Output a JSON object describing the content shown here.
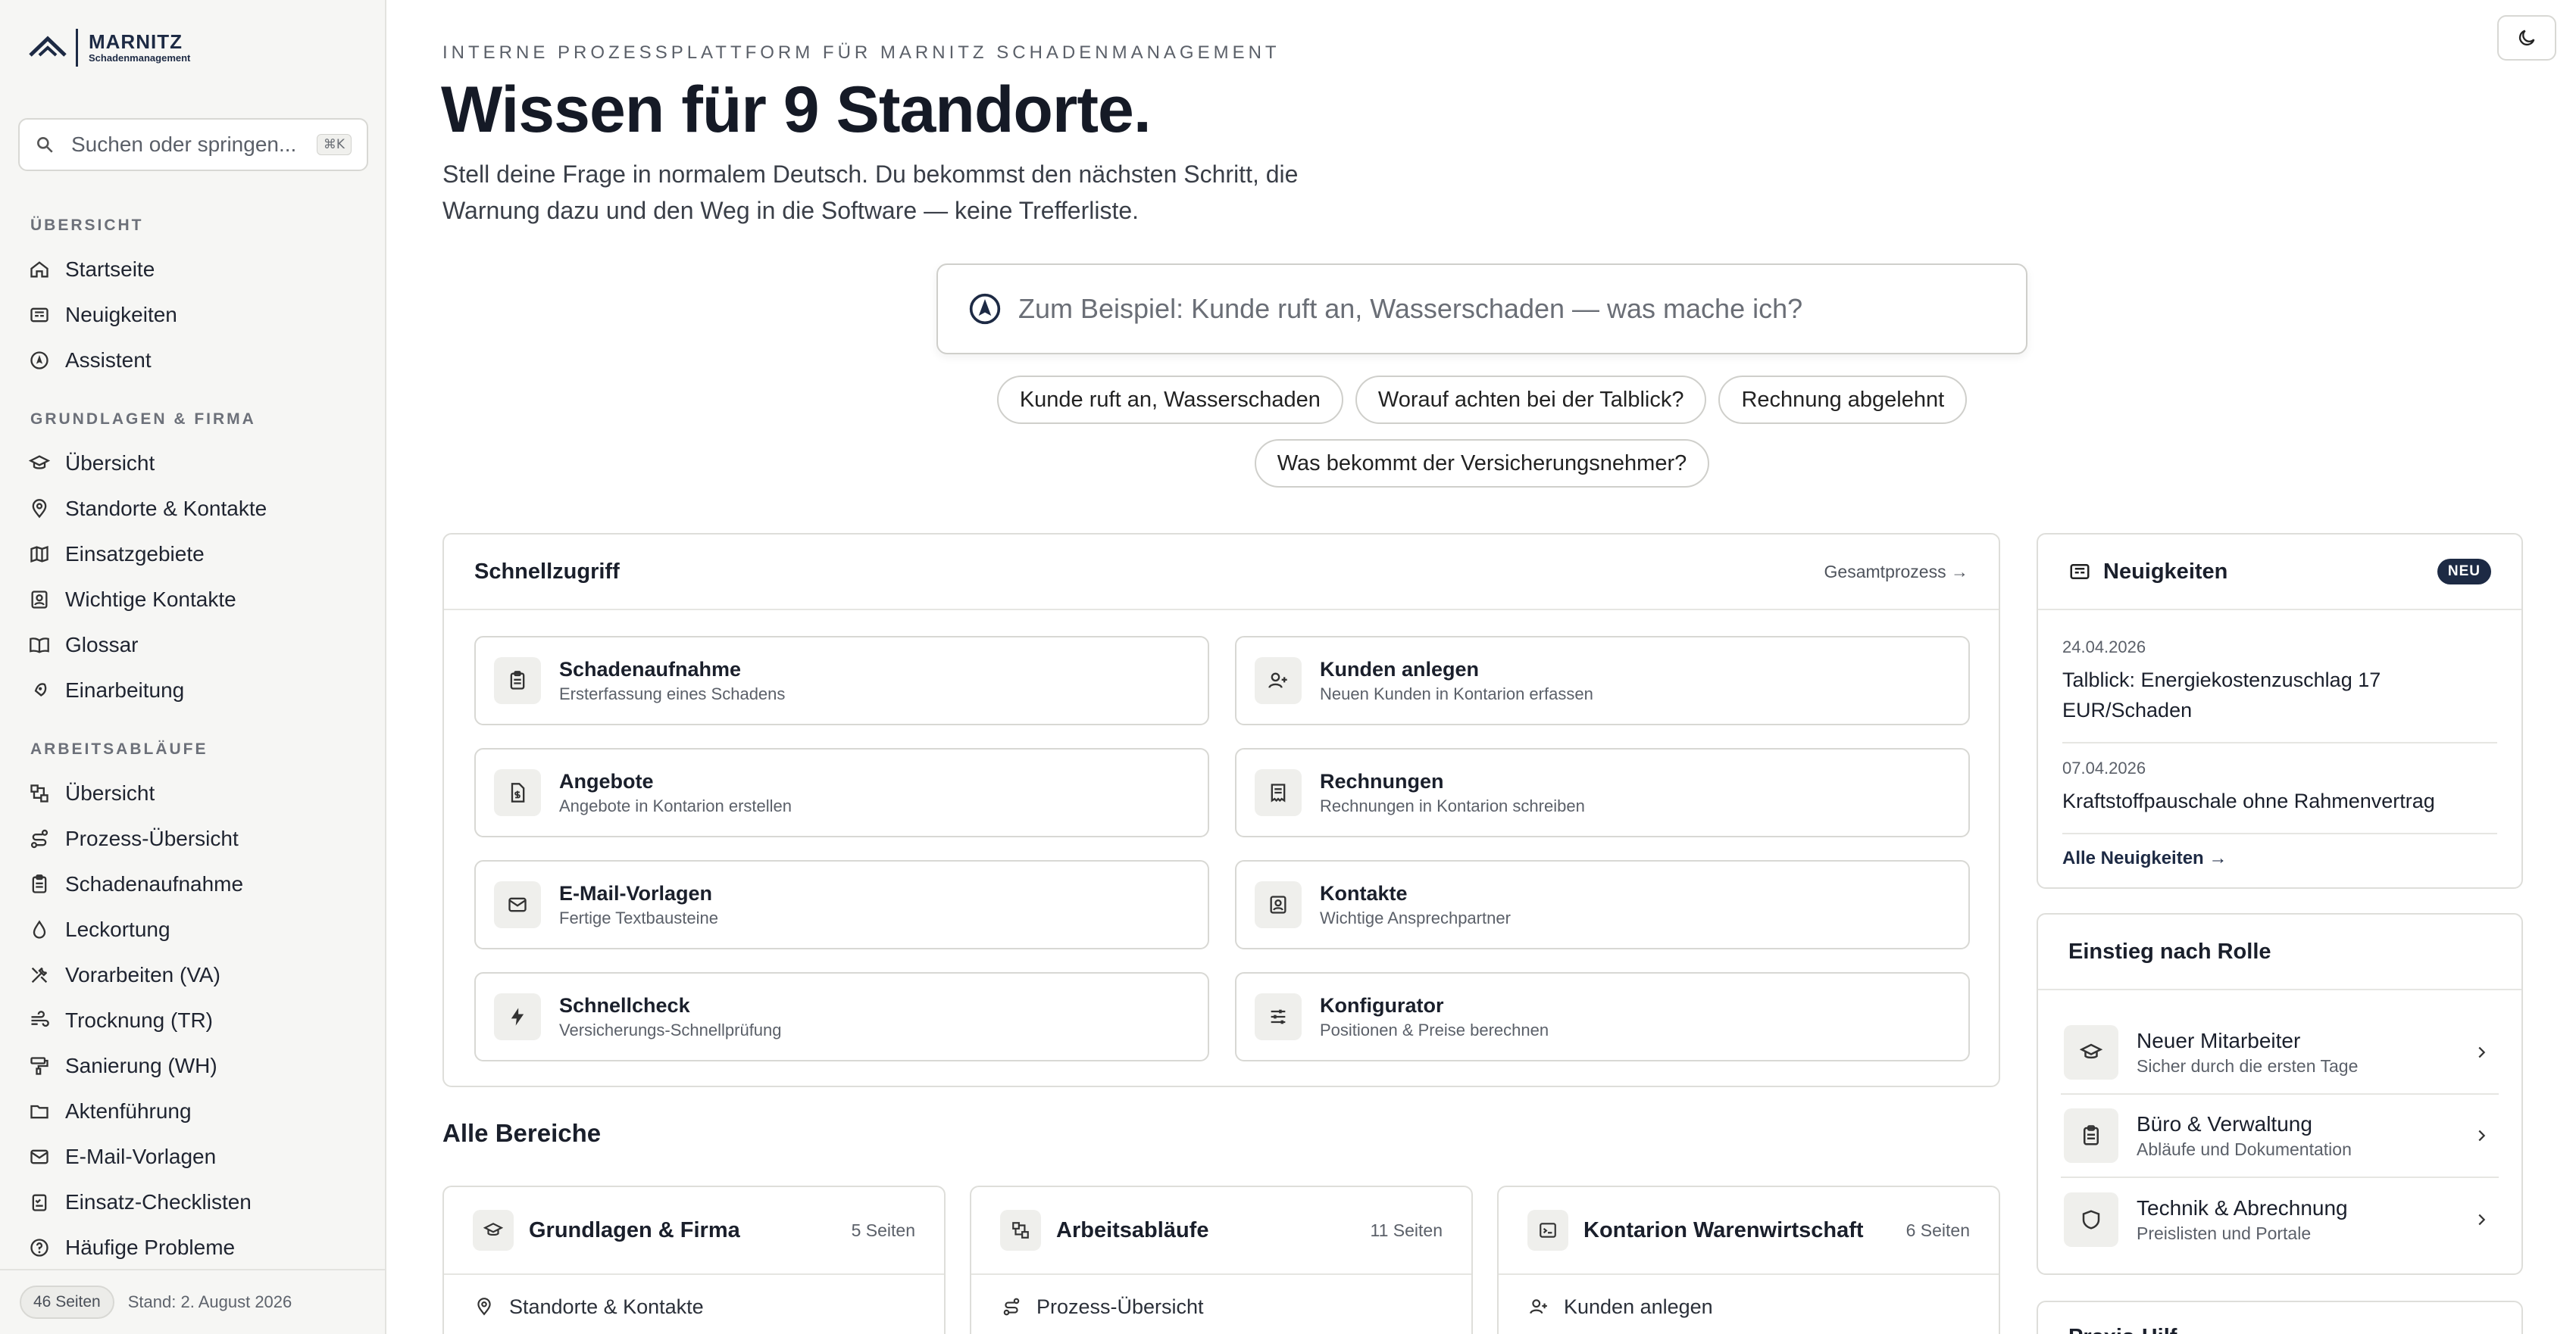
{
  "brand": {
    "name": "MARNITZ",
    "sub": "Schadenmanagement"
  },
  "search": {
    "placeholder": "Suchen oder springen...",
    "shortcut": "⌘K"
  },
  "sidebar": {
    "sections": [
      {
        "title": "ÜBERSICHT",
        "items": [
          {
            "label": "Startseite",
            "icon": "home-icon"
          },
          {
            "label": "Neuigkeiten",
            "icon": "newspaper-icon"
          },
          {
            "label": "Assistent",
            "icon": "compass-icon"
          }
        ]
      },
      {
        "title": "GRUNDLAGEN & FIRMA",
        "items": [
          {
            "label": "Übersicht",
            "icon": "graduation-cap-icon"
          },
          {
            "label": "Standorte & Kontakte",
            "icon": "map-pin-icon"
          },
          {
            "label": "Einsatzgebiete",
            "icon": "map-icon"
          },
          {
            "label": "Wichtige Kontakte",
            "icon": "contact-card-icon"
          },
          {
            "label": "Glossar",
            "icon": "book-icon"
          },
          {
            "label": "Einarbeitung",
            "icon": "rocket-icon"
          }
        ]
      },
      {
        "title": "ARBEITSABLÄUFE",
        "items": [
          {
            "label": "Übersicht",
            "icon": "workflow-icon"
          },
          {
            "label": "Prozess-Übersicht",
            "icon": "route-icon"
          },
          {
            "label": "Schadenaufnahme",
            "icon": "clipboard-icon"
          },
          {
            "label": "Leckortung",
            "icon": "droplet-icon"
          },
          {
            "label": "Vorarbeiten (VA)",
            "icon": "tools-icon"
          },
          {
            "label": "Trocknung (TR)",
            "icon": "wind-icon"
          },
          {
            "label": "Sanierung (WH)",
            "icon": "paint-roller-icon"
          },
          {
            "label": "Aktenführung",
            "icon": "folder-icon"
          },
          {
            "label": "E-Mail-Vorlagen",
            "icon": "mail-icon"
          },
          {
            "label": "Einsatz-Checklisten",
            "icon": "checklist-icon"
          },
          {
            "label": "Häufige Probleme",
            "icon": "help-circle-icon"
          }
        ]
      }
    ],
    "footer": {
      "pages": "46 Seiten",
      "stand": "Stand: 2. August 2026"
    }
  },
  "hero": {
    "eyebrow": "INTERNE PROZESSPLATTFORM FÜR MARNITZ SCHADENMANAGEMENT",
    "headline": "Wissen für 9 Standorte.",
    "subtext": "Stell deine Frage in normalem Deutsch. Du bekommst den nächsten Schritt, die Warnung dazu und den Weg in die Software — keine Trefferliste.",
    "ask_placeholder": "Zum Beispiel: Kunde ruft an, Wasserschaden — was mache ich?",
    "chips": [
      "Kunde ruft an, Wasserschaden",
      "Worauf achten bei der Talblick?",
      "Rechnung abgelehnt",
      "Was bekommt der Versicherungsnehmer?"
    ]
  },
  "quick": {
    "title": "Schnellzugriff",
    "link": "Gesamtprozess →",
    "items": [
      {
        "title": "Schadenaufnahme",
        "sub": "Ersterfassung eines Schadens",
        "icon": "clipboard-icon"
      },
      {
        "title": "Kunden anlegen",
        "sub": "Neuen Kunden in Kontarion erfassen",
        "icon": "user-plus-icon"
      },
      {
        "title": "Angebote",
        "sub": "Angebote in Kontarion erstellen",
        "icon": "file-dollar-icon"
      },
      {
        "title": "Rechnungen",
        "sub": "Rechnungen in Kontarion schreiben",
        "icon": "receipt-icon"
      },
      {
        "title": "E-Mail-Vorlagen",
        "sub": "Fertige Textbausteine",
        "icon": "mail-icon"
      },
      {
        "title": "Kontakte",
        "sub": "Wichtige Ansprechpartner",
        "icon": "contact-card-icon"
      },
      {
        "title": "Schnellcheck",
        "sub": "Versicherungs-Schnellprüfung",
        "icon": "lightning-icon"
      },
      {
        "title": "Konfigurator",
        "sub": "Positionen & Preise berechnen",
        "icon": "sliders-icon"
      }
    ]
  },
  "areas": {
    "title": "Alle Bereiche",
    "cards": [
      {
        "title": "Grundlagen & Firma",
        "count": "5 Seiten",
        "first": "Standorte & Kontakte",
        "icon": "graduation-cap-icon",
        "first_icon": "map-pin-icon"
      },
      {
        "title": "Arbeitsabläufe",
        "count": "11 Seiten",
        "first": "Prozess-Übersicht",
        "icon": "workflow-icon",
        "first_icon": "route-icon"
      },
      {
        "title": "Kontarion Warenwirtschaft",
        "count": "6 Seiten",
        "first": "Kunden anlegen",
        "icon": "terminal-icon",
        "first_icon": "user-plus-icon"
      }
    ]
  },
  "news": {
    "title": "Neuigkeiten",
    "badge": "NEU",
    "items": [
      {
        "date": "24.04.2026",
        "title": "Talblick: Energiekostenzuschlag 17 EUR/Schaden"
      },
      {
        "date": "07.04.2026",
        "title": "Kraftstoffpauschale ohne Rahmenvertrag"
      }
    ],
    "more": "Alle Neuigkeiten →"
  },
  "roles": {
    "title": "Einstieg nach Rolle",
    "items": [
      {
        "title": "Neuer Mitarbeiter",
        "sub": "Sicher durch die ersten Tage",
        "icon": "graduation-cap-icon"
      },
      {
        "title": "Büro & Verwaltung",
        "sub": "Abläufe und Dokumentation",
        "icon": "clipboard-icon"
      },
      {
        "title": "Technik & Abrechnung",
        "sub": "Preislisten und Portale",
        "icon": "shield-icon"
      }
    ]
  },
  "partial_card": {
    "title": "Praxis-Hilf"
  },
  "colors": {
    "brand": "#1d2a44",
    "background": "#ffffff",
    "sidebar": "#f6f6f4"
  }
}
